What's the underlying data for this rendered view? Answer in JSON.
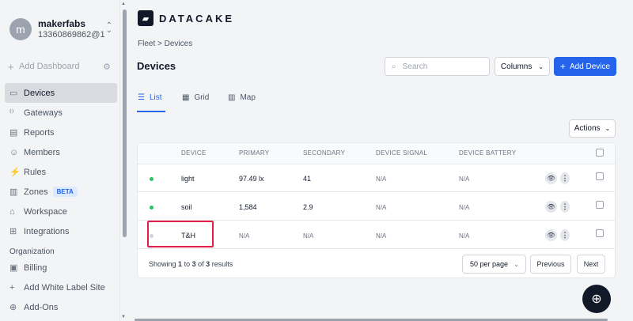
{
  "sidebar": {
    "user": {
      "avatar_letter": "m",
      "name": "makerfabs",
      "id": "13360869862@1..."
    },
    "add_dashboard": "Add Dashboard",
    "items": [
      {
        "label": "Devices",
        "icon": "devices-icon",
        "glyph": "▭"
      },
      {
        "label": "Gateways",
        "icon": "gateway-icon",
        "glyph": "⁽⁾"
      },
      {
        "label": "Reports",
        "icon": "report-icon",
        "glyph": "▤"
      },
      {
        "label": "Members",
        "icon": "members-icon",
        "glyph": "☺"
      },
      {
        "label": "Rules",
        "icon": "rules-icon",
        "glyph": "⚡"
      },
      {
        "label": "Zones",
        "icon": "zones-icon",
        "glyph": "▥",
        "badge": "BETA"
      },
      {
        "label": "Workspace",
        "icon": "workspace-icon",
        "glyph": "⌂"
      },
      {
        "label": "Integrations",
        "icon": "integrations-icon",
        "glyph": "⊞"
      }
    ],
    "org_label": "Organization",
    "org_items": [
      {
        "label": "Billing",
        "icon": "billing-icon",
        "glyph": "▣"
      },
      {
        "label": "Add White Label Site",
        "icon": "plus-icon",
        "glyph": "+"
      },
      {
        "label": "Add-Ons",
        "icon": "addons-icon",
        "glyph": "⊕"
      }
    ]
  },
  "header": {
    "logo_text": "DATACAKE",
    "breadcrumb": "Fleet  >  Devices",
    "title": "Devices",
    "search_placeholder": "Search",
    "columns_label": "Columns",
    "add_device_label": "Add Device"
  },
  "tabs": [
    {
      "label": "List",
      "active": true
    },
    {
      "label": "Grid",
      "active": false
    },
    {
      "label": "Map",
      "active": false
    }
  ],
  "actions_label": "Actions",
  "table": {
    "columns": [
      "DEVICE",
      "PRIMARY",
      "SECONDARY",
      "DEVICE SIGNAL",
      "DEVICE BATTERY"
    ],
    "rows": [
      {
        "device": "light",
        "primary": "97.49 lx",
        "secondary": "41",
        "signal": "N/A",
        "battery": "N/A",
        "status_color": "#22c55e"
      },
      {
        "device": "soil",
        "primary": "1,584",
        "secondary": "2.9",
        "signal": "N/A",
        "battery": "N/A",
        "status_color": "#22c55e"
      },
      {
        "device": "T&H",
        "primary": "N/A",
        "secondary": "N/A",
        "signal": "N/A",
        "battery": "N/A",
        "status_color": "#d1d5db"
      }
    ]
  },
  "pagination": {
    "showing": "Showing",
    "from": "1",
    "to_word": "to",
    "to": "3",
    "of_word": "of",
    "total": "3",
    "results": "results",
    "per_page": "50 per page",
    "previous": "Previous",
    "next": "Next"
  },
  "colors": {
    "accent": "#2563eb",
    "highlight": "#e11d48",
    "online": "#22c55e"
  }
}
